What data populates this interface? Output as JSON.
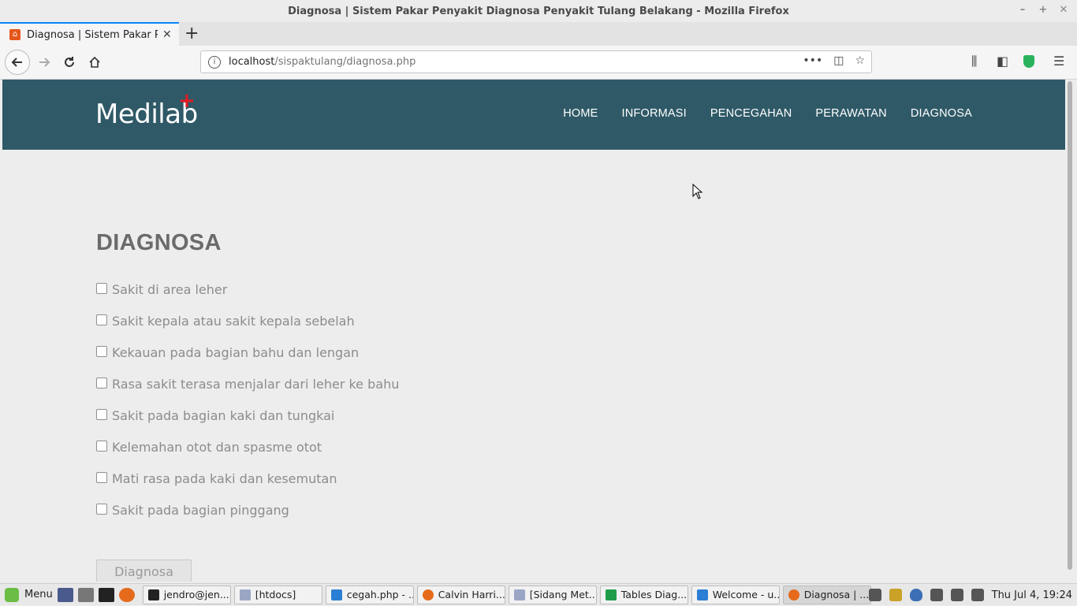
{
  "window": {
    "title": "Diagnosa | Sistem Pakar Penyakit Diagnosa Penyakit Tulang Belakang - Mozilla Firefox"
  },
  "tab": {
    "title": "Diagnosa | Sistem Pakar Penyakit Diagnosa Penyakit Tulang Belakang"
  },
  "address_bar": {
    "host": "localhost",
    "path": "/sispaktulang/diagnosa.php"
  },
  "site": {
    "logo_text": "Medilab",
    "logo_accent": "+",
    "header_color": "#2f5967",
    "accent_color": "#e31b23",
    "menu": [
      "HOME",
      "INFORMASI",
      "PENCEGAHAN",
      "PERAWATAN",
      "DIAGNOSA"
    ]
  },
  "diagnosa": {
    "title": "DIAGNOSA",
    "symptoms": [
      {
        "label": "Sakit di area leher",
        "checked": false
      },
      {
        "label": "Sakit kepala atau sakit kepala sebelah",
        "checked": false
      },
      {
        "label": "Kekauan pada bagian bahu dan lengan",
        "checked": false
      },
      {
        "label": "Rasa sakit terasa menjalar dari leher ke bahu",
        "checked": false
      },
      {
        "label": "Sakit pada bagian kaki dan tungkai",
        "checked": false
      },
      {
        "label": "Kelemahan otot dan spasme otot",
        "checked": false
      },
      {
        "label": "Mati rasa pada kaki dan kesemutan",
        "checked": false
      },
      {
        "label": "Sakit pada bagian pinggang",
        "checked": false
      }
    ],
    "button_label": "Diagnosa"
  },
  "taskbar": {
    "menu_label": "Menu",
    "tasks": [
      {
        "label": "jendro@jen...",
        "icon": "terminal-icon"
      },
      {
        "label": "[htdocs]",
        "icon": "folder-icon"
      },
      {
        "label": "cegah.php - ...",
        "icon": "vscode-icon"
      },
      {
        "label": "Calvin Harri...",
        "icon": "firefox-icon"
      },
      {
        "label": "[Sidang Met...",
        "icon": "folder-icon"
      },
      {
        "label": "Tables Diag...",
        "icon": "spreadsheet-icon"
      },
      {
        "label": "Welcome - u...",
        "icon": "vscode-icon"
      },
      {
        "label": "Diagnosa | ...",
        "icon": "firefox-icon"
      }
    ],
    "clock": "Thu Jul  4, 19:24"
  }
}
